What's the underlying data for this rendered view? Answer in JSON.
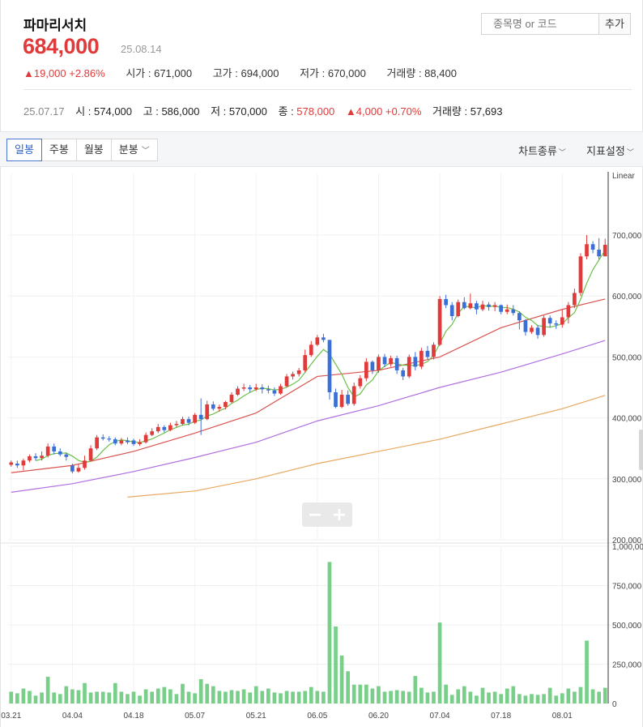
{
  "stock": {
    "name": "파마리서치",
    "price": "684,000",
    "date": "25.08.14",
    "change": "▲19,000 +2.86%",
    "open_label": "시가 : 671,000",
    "high_label": "고가 : 694,000",
    "low_label": "저가 : 670,000",
    "volume_label": "거래량 : 88,400"
  },
  "search": {
    "placeholder": "종목명 or 코드",
    "add_label": "추가"
  },
  "prev": {
    "date": "25.07.17",
    "open": "시 : 574,000",
    "high": "고 : 586,000",
    "low": "저 : 570,000",
    "close_prefix": "종 : ",
    "close": "578,000",
    "change": "▲4,000 +0.70%",
    "volume": "거래량 : 57,693"
  },
  "toolbar": {
    "tabs": [
      "일봉",
      "주봉",
      "월봉",
      "분봉"
    ],
    "active_tab": "일봉",
    "chart_type": "차트종류",
    "indicator": "지표설정"
  },
  "colors": {
    "up": "#e03a3a",
    "down": "#3a6fd8",
    "ma5": "#6cc04a",
    "ma20": "#d9534f",
    "ma60": "#b06fe0",
    "ma120": "#e8a860",
    "volume": "#79cf8a"
  },
  "chart_data": {
    "type": "candlestick",
    "scale_label": "Linear",
    "price_ticks": [
      "700,000",
      "600,000",
      "500,000",
      "400,000",
      "300,000",
      "200,000"
    ],
    "price_tick_values": [
      700000,
      600000,
      500000,
      400000,
      300000,
      200000
    ],
    "volume_ticks": [
      "1,000,000",
      "750,000",
      "500,000",
      "250,000",
      "0"
    ],
    "volume_tick_values": [
      1000000,
      750000,
      500000,
      250000,
      0
    ],
    "x_labels": [
      "03.21",
      "04.04",
      "04.18",
      "05.07",
      "05.21",
      "06.05",
      "06.20",
      "07.04",
      "07.18",
      "08.01"
    ],
    "x_label_index": [
      0,
      10,
      20,
      30,
      40,
      50,
      60,
      70,
      80,
      90
    ],
    "candles": [
      [
        323000,
        327000,
        330000,
        320000
      ],
      [
        325000,
        322000,
        330000,
        318000
      ],
      [
        322000,
        330000,
        333000,
        314000
      ],
      [
        330000,
        337000,
        340000,
        327000
      ],
      [
        337000,
        334000,
        342000,
        330000
      ],
      [
        334000,
        338000,
        345000,
        330000
      ],
      [
        338000,
        353000,
        358000,
        335000
      ],
      [
        353000,
        345000,
        358000,
        340000
      ],
      [
        345000,
        340000,
        350000,
        337000
      ],
      [
        340000,
        336000,
        343000,
        330000
      ],
      [
        322000,
        312000,
        325000,
        309000
      ],
      [
        312000,
        318000,
        324000,
        310000
      ],
      [
        318000,
        330000,
        338000,
        315000
      ],
      [
        330000,
        350000,
        355000,
        328000
      ],
      [
        350000,
        368000,
        372000,
        347000
      ],
      [
        368000,
        366000,
        373000,
        363000
      ],
      [
        366000,
        365000,
        370000,
        361000
      ],
      [
        365000,
        358000,
        368000,
        355000
      ],
      [
        358000,
        363000,
        367000,
        355000
      ],
      [
        363000,
        360000,
        368000,
        357000
      ],
      [
        363000,
        357000,
        366000,
        354000
      ],
      [
        357000,
        360000,
        365000,
        354000
      ],
      [
        360000,
        372000,
        376000,
        358000
      ],
      [
        372000,
        378000,
        383000,
        370000
      ],
      [
        378000,
        385000,
        390000,
        375000
      ],
      [
        385000,
        380000,
        388000,
        376000
      ],
      [
        380000,
        388000,
        392000,
        378000
      ],
      [
        388000,
        390000,
        395000,
        385000
      ],
      [
        390000,
        398000,
        402000,
        388000
      ],
      [
        398000,
        392000,
        402000,
        388000
      ],
      [
        392000,
        405000,
        408000,
        390000
      ],
      [
        405000,
        398000,
        432000,
        372000
      ],
      [
        398000,
        422000,
        428000,
        396000
      ],
      [
        422000,
        415000,
        427000,
        412000
      ],
      [
        415000,
        418000,
        422000,
        410000
      ],
      [
        418000,
        426000,
        428000,
        414000
      ],
      [
        426000,
        438000,
        442000,
        424000
      ],
      [
        438000,
        448000,
        452000,
        436000
      ],
      [
        448000,
        450000,
        456000,
        444000
      ],
      [
        450000,
        447000,
        454000,
        442000
      ],
      [
        447000,
        450000,
        456000,
        444000
      ],
      [
        450000,
        447000,
        455000,
        440000
      ],
      [
        447000,
        445000,
        453000,
        440000
      ],
      [
        445000,
        440000,
        450000,
        436000
      ],
      [
        440000,
        452000,
        456000,
        438000
      ],
      [
        452000,
        468000,
        472000,
        450000
      ],
      [
        468000,
        472000,
        476000,
        463000
      ],
      [
        472000,
        478000,
        482000,
        468000
      ],
      [
        478000,
        503000,
        512000,
        475000
      ],
      [
        503000,
        520000,
        526000,
        500000
      ],
      [
        520000,
        532000,
        536000,
        518000
      ],
      [
        532000,
        528000,
        538000,
        524000
      ],
      [
        528000,
        442000,
        452000,
        430000
      ],
      [
        442000,
        418000,
        448000,
        416000
      ],
      [
        418000,
        438000,
        446000,
        416000
      ],
      [
        438000,
        423000,
        445000,
        420000
      ],
      [
        423000,
        452000,
        458000,
        420000
      ],
      [
        452000,
        465000,
        470000,
        448000
      ],
      [
        465000,
        492000,
        498000,
        460000
      ],
      [
        492000,
        478000,
        494000,
        472000
      ],
      [
        478000,
        500000,
        504000,
        474000
      ],
      [
        500000,
        488000,
        505000,
        483000
      ],
      [
        488000,
        498000,
        502000,
        484000
      ],
      [
        498000,
        478000,
        502000,
        472000
      ],
      [
        478000,
        468000,
        482000,
        462000
      ],
      [
        468000,
        500000,
        504000,
        465000
      ],
      [
        500000,
        484000,
        508000,
        478000
      ],
      [
        484000,
        510000,
        515000,
        480000
      ],
      [
        510000,
        500000,
        518000,
        496000
      ],
      [
        500000,
        520000,
        524000,
        496000
      ],
      [
        520000,
        595000,
        600000,
        518000
      ],
      [
        595000,
        585000,
        602000,
        580000
      ],
      [
        585000,
        567000,
        590000,
        560000
      ],
      [
        567000,
        590000,
        594000,
        565000
      ],
      [
        590000,
        580000,
        598000,
        578000
      ],
      [
        580000,
        588000,
        604000,
        578000
      ],
      [
        588000,
        578000,
        592000,
        570000
      ],
      [
        578000,
        586000,
        592000,
        575000
      ],
      [
        586000,
        582000,
        590000,
        576000
      ],
      [
        582000,
        585000,
        590000,
        575000
      ],
      [
        585000,
        574000,
        586000,
        570000
      ],
      [
        574000,
        578000,
        586000,
        570000
      ],
      [
        578000,
        572000,
        585000,
        568000
      ],
      [
        572000,
        560000,
        575000,
        545000
      ],
      [
        560000,
        541000,
        562000,
        535000
      ],
      [
        541000,
        548000,
        552000,
        538000
      ],
      [
        548000,
        536000,
        552000,
        530000
      ],
      [
        536000,
        564000,
        568000,
        533000
      ],
      [
        564000,
        555000,
        568000,
        548000
      ],
      [
        555000,
        553000,
        560000,
        546000
      ],
      [
        553000,
        565000,
        578000,
        548000
      ],
      [
        565000,
        585000,
        590000,
        555000
      ],
      [
        585000,
        605000,
        612000,
        580000
      ],
      [
        605000,
        665000,
        670000,
        600000
      ],
      [
        665000,
        685000,
        700000,
        660000
      ],
      [
        685000,
        676000,
        690000,
        670000
      ],
      [
        676000,
        665000,
        695000,
        660000
      ],
      [
        665000,
        684000,
        694000,
        670000
      ]
    ],
    "volume": [
      75000,
      65000,
      95000,
      80000,
      50000,
      70000,
      170000,
      70000,
      60000,
      110000,
      90000,
      85000,
      130000,
      70000,
      75000,
      75000,
      70000,
      130000,
      75000,
      60000,
      75000,
      50000,
      90000,
      75000,
      95000,
      105000,
      90000,
      60000,
      125000,
      75000,
      65000,
      155000,
      125000,
      110000,
      80000,
      75000,
      85000,
      80000,
      90000,
      70000,
      110000,
      80000,
      95000,
      70000,
      65000,
      80000,
      75000,
      75000,
      80000,
      105000,
      80000,
      75000,
      900000,
      490000,
      305000,
      205000,
      120000,
      120000,
      120000,
      95000,
      110000,
      75000,
      80000,
      85000,
      80000,
      75000,
      175000,
      100000,
      70000,
      75000,
      515000,
      120000,
      55000,
      90000,
      110000,
      75000,
      50000,
      100000,
      70000,
      75000,
      60000,
      95000,
      110000,
      60000,
      50000,
      60000,
      55000,
      60000,
      100000,
      50000,
      65000,
      95000,
      75000,
      105000,
      400000,
      90000,
      75000,
      100000
    ],
    "ma_lines": [
      {
        "name": "MA5",
        "color": "#6cc04a",
        "start": 4
      },
      {
        "name": "MA20",
        "color": "#d9534f",
        "start": 0
      },
      {
        "name": "MA60",
        "color": "#b06fe0",
        "start": 0
      },
      {
        "name": "MA120",
        "color": "#e8a860",
        "start": 19
      }
    ],
    "ma20_points": [
      [
        0,
        310000
      ],
      [
        10,
        322000
      ],
      [
        20,
        345000
      ],
      [
        30,
        375000
      ],
      [
        40,
        408000
      ],
      [
        50,
        468000
      ],
      [
        60,
        478000
      ],
      [
        70,
        500000
      ],
      [
        80,
        548000
      ],
      [
        90,
        578000
      ],
      [
        97,
        595000
      ]
    ],
    "ma60_points": [
      [
        0,
        278000
      ],
      [
        10,
        292000
      ],
      [
        20,
        312000
      ],
      [
        30,
        335000
      ],
      [
        40,
        360000
      ],
      [
        50,
        395000
      ],
      [
        60,
        420000
      ],
      [
        70,
        450000
      ],
      [
        80,
        475000
      ],
      [
        90,
        505000
      ],
      [
        97,
        527000
      ]
    ],
    "ma120_points": [
      [
        19,
        270000
      ],
      [
        30,
        280000
      ],
      [
        40,
        300000
      ],
      [
        50,
        325000
      ],
      [
        60,
        345000
      ],
      [
        70,
        365000
      ],
      [
        80,
        390000
      ],
      [
        90,
        415000
      ],
      [
        97,
        437000
      ]
    ],
    "price_range": [
      200000,
      800000
    ],
    "volume_range": [
      0,
      1000000
    ]
  }
}
